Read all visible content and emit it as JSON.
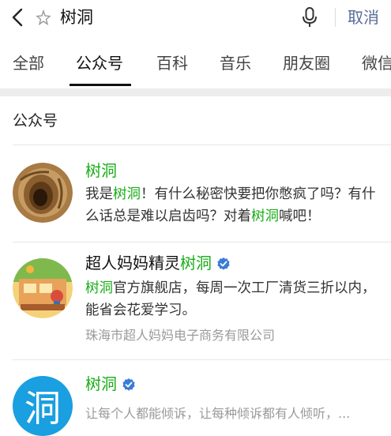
{
  "search": {
    "back_icon": "chevron-left-icon",
    "search_icon": "star-search-icon",
    "query": "树洞",
    "mic_icon": "microphone-icon",
    "cancel_label": "取消"
  },
  "tabs": [
    {
      "label": "全部",
      "active": false
    },
    {
      "label": "公众号",
      "active": true
    },
    {
      "label": "百科",
      "active": false
    },
    {
      "label": "音乐",
      "active": false
    },
    {
      "label": "朋友圈",
      "active": false
    },
    {
      "label": "微信",
      "active": false
    }
  ],
  "section_title": "公众号",
  "results": [
    {
      "name": "树洞",
      "desc_parts": [
        "我是",
        "树洞",
        "！有什么秘密快要把你憋疯了吗？有什么话总是难以启齿吗？对着",
        "树洞",
        "喊吧！"
      ]
    },
    {
      "name_prefix": "超人妈妈精灵",
      "name_highlight": "树洞",
      "verified_icon": "verified-badge-icon",
      "desc_parts": [
        "树洞",
        "官方旗舰店，每周一次工厂清货三折以内，能省会花爱学习。"
      ],
      "company": "珠海市超人妈妈电子商务有限公司"
    },
    {
      "name": "树洞",
      "verified_icon": "verified-badge-icon",
      "avatar_char": "洞",
      "desc": "让每个人都能倾诉，让每种倾诉都有人倾听，..."
    }
  ],
  "colors": {
    "highlight": "#1aad19",
    "link": "#576b95",
    "verified": "#3a7bd5",
    "avatar_blue": "#1a9fe0"
  }
}
